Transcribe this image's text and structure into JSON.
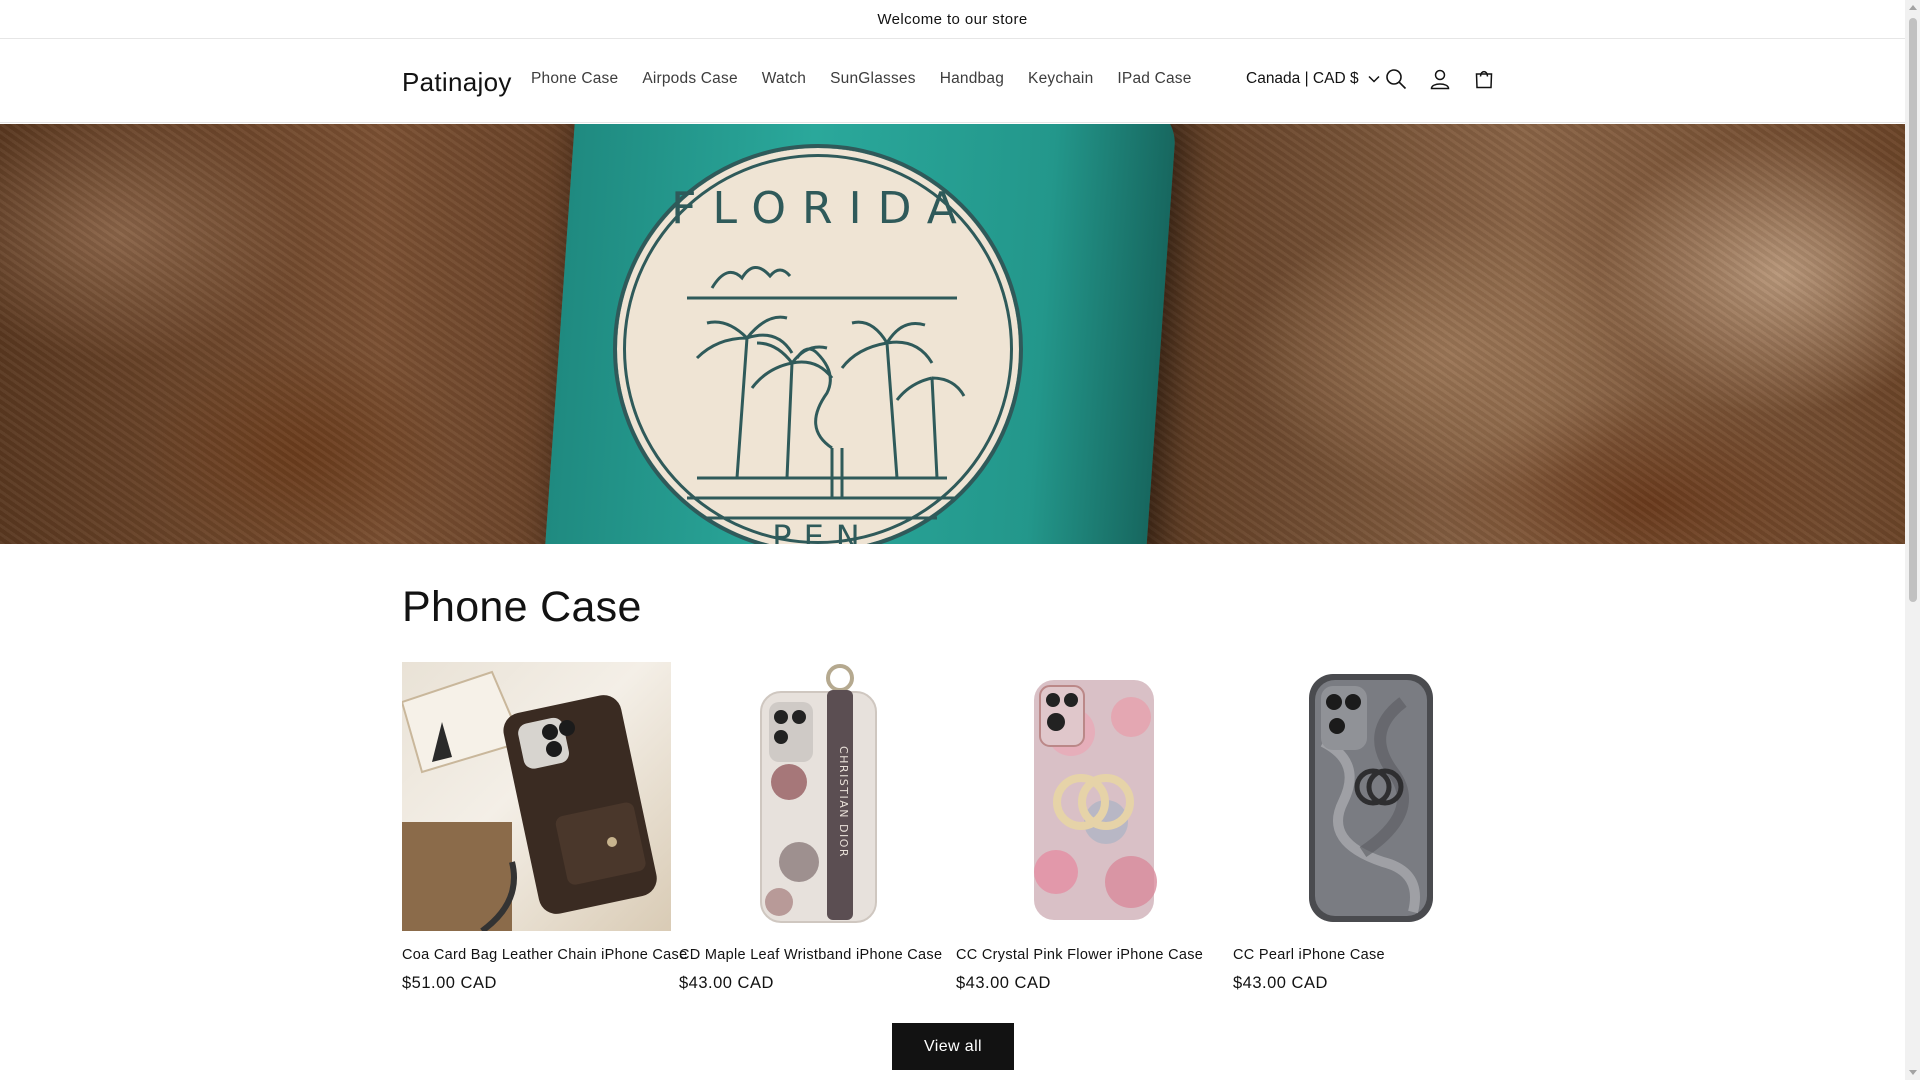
{
  "announcement": {
    "text": "Welcome to our store"
  },
  "header": {
    "logo": "Patinajoy",
    "nav": [
      "Phone Case",
      "Airpods Case",
      "Watch",
      "SunGlasses",
      "Handbag",
      "Keychain",
      "IPad Case"
    ],
    "country_selector": "Canada | CAD $",
    "icons": [
      "search-icon",
      "account-icon",
      "cart-icon"
    ]
  },
  "hero": {
    "image_text": [
      "FLORIDA",
      "PEN"
    ],
    "colors": {
      "case": "#2aa89b",
      "badge": "#efe4d4",
      "ink": "#2f5a5a"
    }
  },
  "collection": {
    "title": "Phone Case",
    "products": [
      {
        "title": "Coa Card Bag Leather Chain iPhone Case",
        "price": "$51.00 CAD"
      },
      {
        "title": "CD Maple Leaf Wristband iPhone Case",
        "price": "$43.00 CAD"
      },
      {
        "title": "CC Crystal Pink Flower iPhone Case",
        "price": "$43.00 CAD"
      },
      {
        "title": "CC Pearl iPhone Case",
        "price": "$43.00 CAD"
      }
    ],
    "view_all": "View all"
  }
}
